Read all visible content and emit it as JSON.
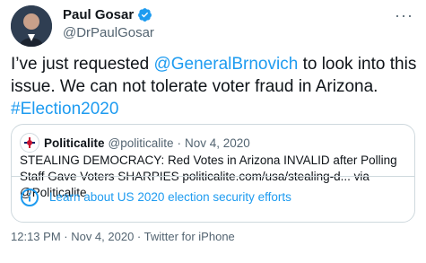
{
  "author": {
    "name": "Paul Gosar",
    "handle": "@DrPaulGosar"
  },
  "tweet": {
    "text_before": "I’ve just requested ",
    "mention": "@GeneralBrnovich",
    "text_after": " to look into this issue.  We can not tolerate voter fraud in Arizona. ",
    "hashtag": "#Election2020"
  },
  "quote": {
    "name": "Politicalite",
    "handle": "@politicalite",
    "separator": "·",
    "date": "Nov 4, 2020",
    "text": "STEALING DEMOCRACY: Red Votes in Arizona INVALID after Polling Staff Gave Voters SHARPIES  politicalite.com/usa/stealing-d... via @Politicalite"
  },
  "notice": {
    "label": "Learn about US 2020 election security efforts"
  },
  "meta": {
    "text": "12:13 PM · Nov 4, 2020 · Twitter for iPhone"
  },
  "colors": {
    "accent": "#1d9bf0",
    "text": "#0f1419",
    "muted": "#536471",
    "border": "#cfd9de"
  }
}
